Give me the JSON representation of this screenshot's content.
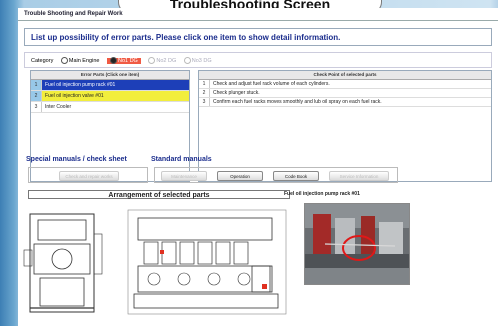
{
  "tab_title": "Troubleshooting Screen",
  "window": {
    "title": "Trouble Shooting and Repair Work"
  },
  "instruction": "List up possibility of error parts. Please click one item to show detail information.",
  "category": {
    "label": "Category",
    "options": [
      "Main Engine",
      "No1 DG",
      "No2 DG",
      "No3 DG"
    ],
    "selected": "No1 DG"
  },
  "error_parts": {
    "header": "Error Parts (Click one item)",
    "rows": [
      {
        "num": "1",
        "text": "Fuel oil injection pump rack #01"
      },
      {
        "num": "2",
        "text": "Fuel oil injection valve #01"
      },
      {
        "num": "3",
        "text": "Inter Cooler"
      }
    ]
  },
  "check_points": {
    "header": "Check Point of selected parts",
    "rows": [
      {
        "num": "1",
        "text": "Check and adjust fuel rack volume of each cylinders."
      },
      {
        "num": "2",
        "text": "Check plunger stuck."
      },
      {
        "num": "3",
        "text": "Confirm each fuel racks moves smoothly and lub oil spray on each fuel rack."
      }
    ]
  },
  "special_manuals": {
    "title": "Special manuals / check sheet",
    "button": "Check and repair works"
  },
  "standard_manuals": {
    "title": "Standard manuals",
    "buttons": [
      "Maintenance",
      "Operation",
      "Code Book",
      "Service Information"
    ]
  },
  "arrangement": {
    "title": "Arrangement of selected parts"
  },
  "selected_part": {
    "label": "Fuel oil injection pump rack #01"
  },
  "colors": {
    "accent_blue": "#1d3fb8",
    "highlight_yellow": "#f2ee3c",
    "selected_red": "#f05a44",
    "title_blue": "#1a2c8c"
  }
}
